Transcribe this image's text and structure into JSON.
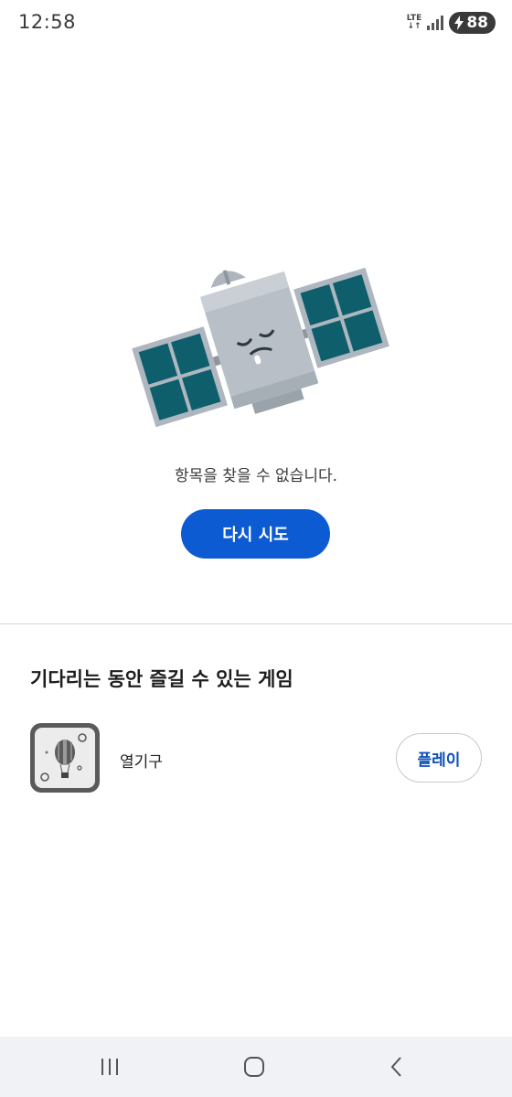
{
  "status_bar": {
    "time": "12:58",
    "network": "LTE",
    "battery_level": "88",
    "icons": [
      "lte-icon",
      "signal-icon",
      "charging-bolt-icon"
    ]
  },
  "empty_state": {
    "illustration": "satellite-sleeping-icon",
    "message": "항목을 찾을 수 없습니다.",
    "retry_label": "다시 시도"
  },
  "games_section": {
    "title": "기다리는 동안 즐길 수 있는 게임",
    "games": [
      {
        "name": "열기구",
        "icon": "hot-air-balloon-icon",
        "play_label": "플레이"
      }
    ]
  },
  "nav_bar": {
    "buttons": [
      "recents-icon",
      "home-icon",
      "back-icon"
    ]
  },
  "colors": {
    "accent": "#0d5bd3",
    "play_text": "#0d4fb8",
    "satellite_panel": "#0e5e6c",
    "satellite_body": "#b8bfc6",
    "nav_bg": "#f1f2f6"
  }
}
